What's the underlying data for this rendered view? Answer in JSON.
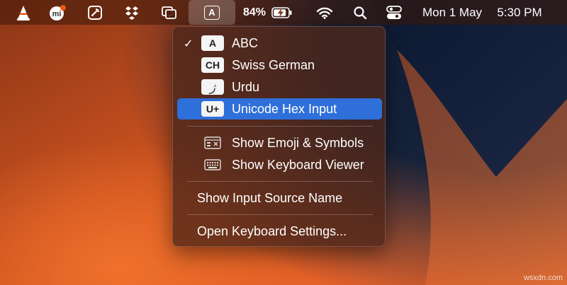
{
  "menubar": {
    "battery_percent": "84%",
    "date": "Mon 1 May",
    "time": "5:30 PM",
    "input_indicator": "A",
    "icons": [
      "vlc-icon",
      "mi-app-icon",
      "pen-icon",
      "dropbox-icon",
      "window-icon",
      "input-source-icon",
      "battery-charging-icon",
      "wifi-icon",
      "search-icon",
      "control-center-icon"
    ]
  },
  "menu": {
    "input_sources": [
      {
        "badge": "A",
        "label": "ABC",
        "checked": true
      },
      {
        "badge": "CH",
        "label": "Swiss German",
        "checked": false
      },
      {
        "badge": "ژ",
        "label": "Urdu",
        "checked": false
      },
      {
        "badge": "U+",
        "label": "Unicode Hex Input",
        "checked": false,
        "highlighted": true
      }
    ],
    "check_mark": "✓",
    "show_emoji": "Show Emoji & Symbols",
    "show_keyboard_viewer": "Show Keyboard Viewer",
    "show_input_source_name": "Show Input Source Name",
    "open_keyboard_settings": "Open Keyboard Settings..."
  },
  "watermark": "wsxdn.com",
  "colors": {
    "highlight": "#2f6fd9",
    "wallpaper_orange": "#e6622a",
    "wallpaper_navy": "#15223a"
  }
}
